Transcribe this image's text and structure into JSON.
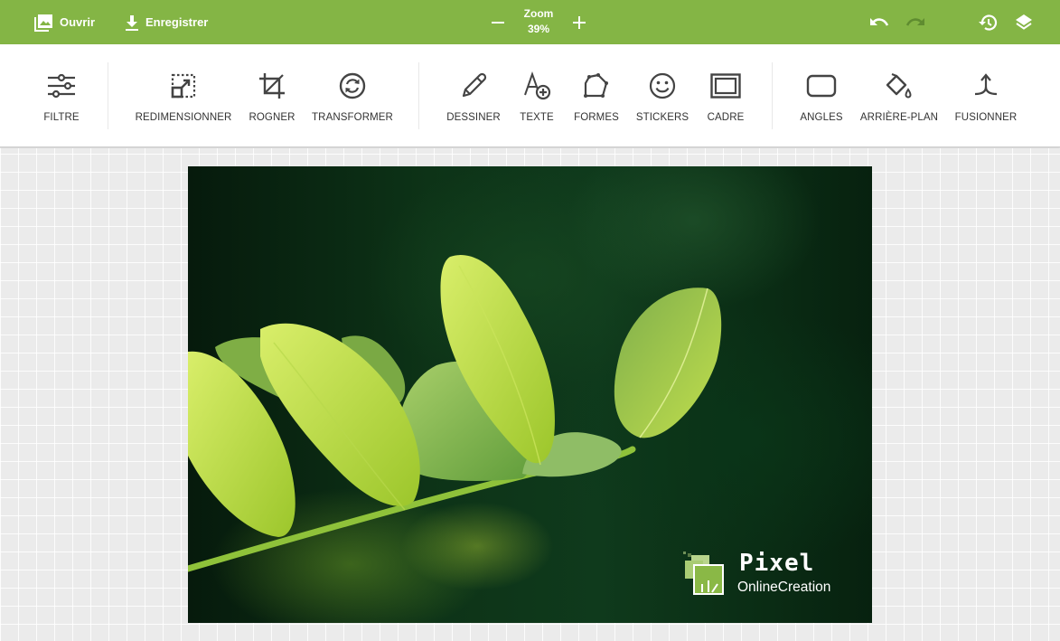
{
  "topbar": {
    "open_label": "Ouvrir",
    "save_label": "Enregistrer",
    "zoom_label": "Zoom",
    "zoom_value": "39%",
    "icons": {
      "open": "image-gallery-icon",
      "save": "download-icon",
      "zoom_out": "minus-icon",
      "zoom_in": "plus-icon",
      "undo": "undo-icon",
      "redo": "redo-icon",
      "history": "history-icon",
      "layers": "layers-icon"
    },
    "redo_enabled": false
  },
  "toolbar": {
    "tools": [
      {
        "id": "filtre",
        "label": "FILTRE",
        "icon": "sliders-icon"
      },
      {
        "id": "redimensionner",
        "label": "REDIMENSIONNER",
        "icon": "resize-icon"
      },
      {
        "id": "rogner",
        "label": "ROGNER",
        "icon": "crop-icon"
      },
      {
        "id": "transformer",
        "label": "TRANSFORMER",
        "icon": "rotate-icon"
      },
      {
        "id": "dessiner",
        "label": "DESSINER",
        "icon": "pencil-icon"
      },
      {
        "id": "texte",
        "label": "TEXTE",
        "icon": "text-add-icon"
      },
      {
        "id": "formes",
        "label": "FORMES",
        "icon": "polygon-icon"
      },
      {
        "id": "stickers",
        "label": "STICKERS",
        "icon": "smiley-icon"
      },
      {
        "id": "cadre",
        "label": "CADRE",
        "icon": "frame-icon"
      },
      {
        "id": "angles",
        "label": "ANGLES",
        "icon": "rounded-rect-icon"
      },
      {
        "id": "arriere_plan",
        "label": "ARRIÈRE-PLAN",
        "icon": "paint-bucket-icon"
      },
      {
        "id": "fusionner",
        "label": "FUSIONNER",
        "icon": "merge-icon"
      }
    ]
  },
  "canvas": {
    "image_description": "Bright green acacia leaves on a branch against a dark green blurred background",
    "watermark": {
      "title": "Pixel",
      "subtitle": "OnlineCreation"
    }
  },
  "colors": {
    "brand_green": "#84b545",
    "toolbar_bg": "#ffffff",
    "icon_color": "#444444",
    "canvas_bg": "#ebebeb"
  }
}
